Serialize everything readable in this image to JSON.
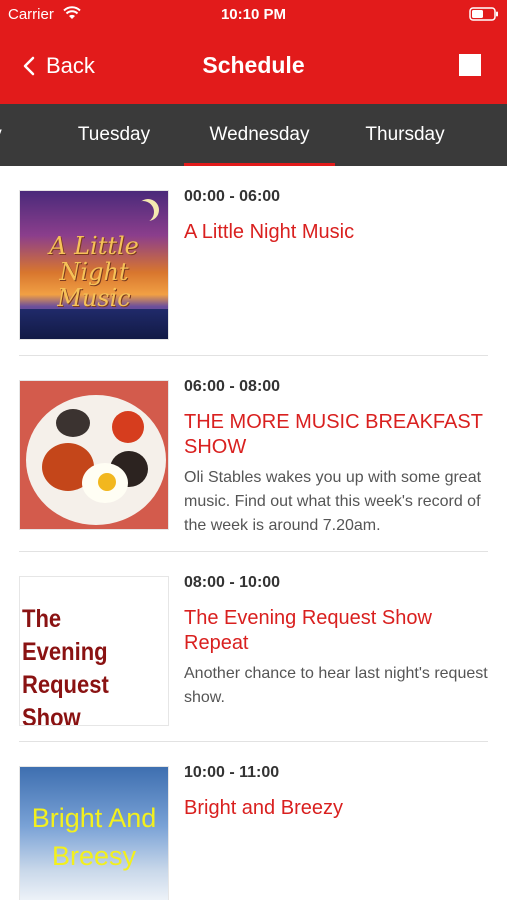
{
  "status": {
    "carrier": "Carrier",
    "time": "10:10 PM"
  },
  "nav": {
    "back_label": "Back",
    "title": "Schedule"
  },
  "tabs": [
    {
      "label": "y",
      "selected": false
    },
    {
      "label": "Tuesday",
      "selected": false
    },
    {
      "label": "Wednesday",
      "selected": true
    },
    {
      "label": "Thursday",
      "selected": false
    }
  ],
  "schedule": [
    {
      "time": "00:00 - 06:00",
      "title": "A Little Night Music",
      "description": "",
      "thumb_text": "A Little Night Music"
    },
    {
      "time": "06:00 - 08:00",
      "title": "THE MORE MUSIC BREAKFAST SHOW",
      "description": "Oli Stables wakes you up with some great music. Find out what this week's record of the week is around 7.20am."
    },
    {
      "time": "08:00 - 10:00",
      "title": "The Evening Request Show Repeat",
      "description": "Another chance to hear last night's request show.",
      "thumb_text": "The Evening Request Show Repeat"
    },
    {
      "time": "10:00 - 11:00",
      "title": "Bright and Breezy",
      "description": "",
      "thumb_text": "Bright And Breesy"
    }
  ],
  "colors": {
    "brand_red": "#e21b1b",
    "title_red": "#d9201f",
    "tab_bg": "#3a3a3a"
  }
}
